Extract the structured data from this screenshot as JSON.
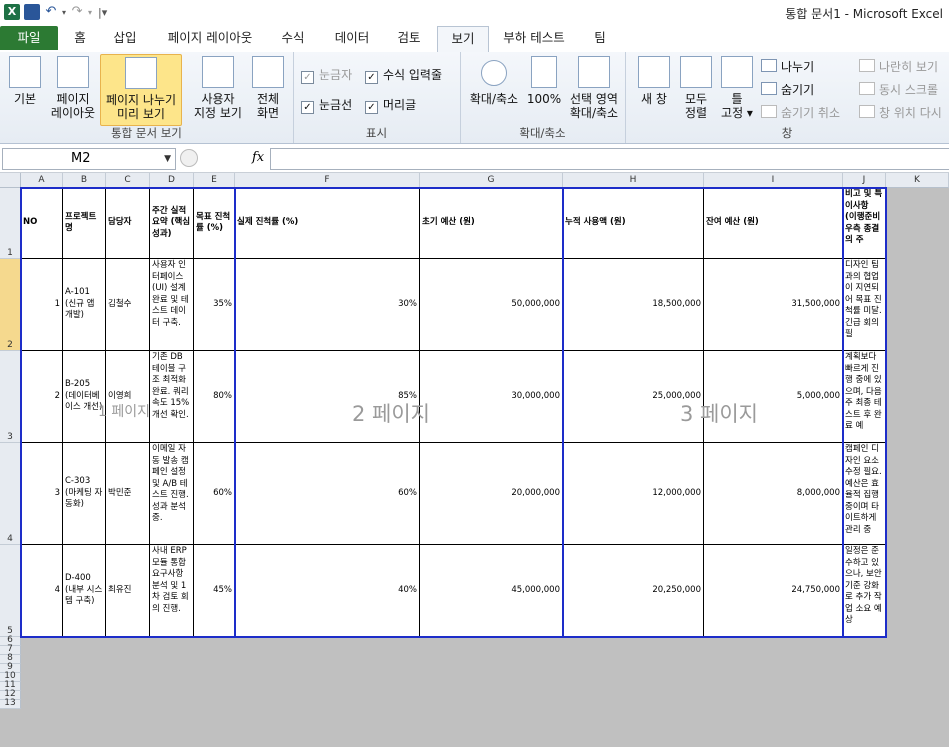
{
  "window": {
    "title": "통합 문서1  -  Microsoft Excel",
    "app_icon": "X"
  },
  "tabs": [
    "파일",
    "홈",
    "삽입",
    "페이지 레이아웃",
    "수식",
    "데이터",
    "검토",
    "보기",
    "부하 테스트",
    "팀"
  ],
  "active_tab": "보기",
  "ribbon": {
    "workbook_views": {
      "label": "통합 문서 보기",
      "normal": "기본",
      "page_layout": [
        "페이지",
        "레이아웃"
      ],
      "page_break": [
        "페이지 나누기",
        "미리 보기"
      ],
      "custom": [
        "사용자",
        "지정 보기"
      ],
      "fullscreen": [
        "전체",
        "화면"
      ]
    },
    "show": {
      "label": "표시",
      "ruler": "눈금자",
      "formula_bar": "수식 입력줄",
      "gridlines": "눈금선",
      "headings": "머리글"
    },
    "zoom": {
      "label": "확대/축소",
      "zoom": "확대/축소",
      "hundred": "100%",
      "selection": [
        "선택 영역",
        "확대/축소"
      ]
    },
    "window": {
      "label": "창",
      "new_window": "새 창",
      "arrange_all": [
        "모두",
        "정렬"
      ],
      "freeze": [
        "틀",
        "고정 ▾"
      ],
      "split": "나누기",
      "hide": "숨기기",
      "unhide": "숨기기 취소",
      "side_by_side": "나란히 보기",
      "sync_scroll": "동시 스크롤",
      "reset_position": "창 위치 다시"
    }
  },
  "formula_bar": {
    "name_box": "M2",
    "fx": "fx",
    "value": ""
  },
  "columns": [
    "A",
    "B",
    "C",
    "D",
    "E",
    "F",
    "G",
    "H",
    "I",
    "J",
    "K"
  ],
  "rows": [
    "1",
    "2",
    "3",
    "4",
    "5",
    "6",
    "7",
    "8",
    "9",
    "10",
    "11",
    "12",
    "13"
  ],
  "selected_row": "2",
  "table": {
    "headers": [
      "NO",
      "프로젝트명",
      "담당자",
      "주간 실적 요약 (핵심 성과)",
      "목표 진척률 (%)",
      "실제 진척률 (%)",
      "초기 예산 (원)",
      "누적 사용액 (원)",
      "잔여 예산 (원)",
      "비고 및 특이사항 (이행준비 우측 종결의 주"
    ],
    "rows": [
      [
        "1",
        "A-101 (신규 앱 개발)",
        "김철수",
        "사용자 인터페이스(UI) 설계 완료 및 테스트 데이터 구축.",
        "35%",
        "30%",
        "50,000,000",
        "18,500,000",
        "31,500,000",
        "디자인 팀과의 협업이 지연되어 목표 진척률 미달. 긴급 회의 필"
      ],
      [
        "2",
        "B-205 (데이터베이스 개선)",
        "이영희",
        "기존 DB 테이블 구조 최적화 완료. 쿼리 속도 15% 개선 확인.",
        "80%",
        "85%",
        "30,000,000",
        "25,000,000",
        "5,000,000",
        "계획보다 빠르게 진행 중에 있으며, 다음 주 최종 테스트 후 완료 예"
      ],
      [
        "3",
        "C-303 (마케팅 자동화)",
        "박민준",
        "이메일 자동 발송 캠페인 설정 및 A/B 테스트 진행. 성과 분석 중.",
        "60%",
        "60%",
        "20,000,000",
        "12,000,000",
        "8,000,000",
        "캠페인 디자인 요소 수정 필요. 예산은 효율적 집행 중이며 타이트하게 관리 중"
      ],
      [
        "4",
        "D-400 (내부 시스템 구축)",
        "최유진",
        "사내 ERP 모듈 통합 요구사항 분석 및 1차 검토 회의 진행.",
        "45%",
        "40%",
        "45,000,000",
        "20,250,000",
        "24,750,000",
        "일정은 준수하고 있으나, 보안 기준 강화로 추가 작업 소요 예상"
      ]
    ]
  },
  "page_labels": [
    "1 페이지",
    "2 페이지",
    "3 페이지"
  ]
}
